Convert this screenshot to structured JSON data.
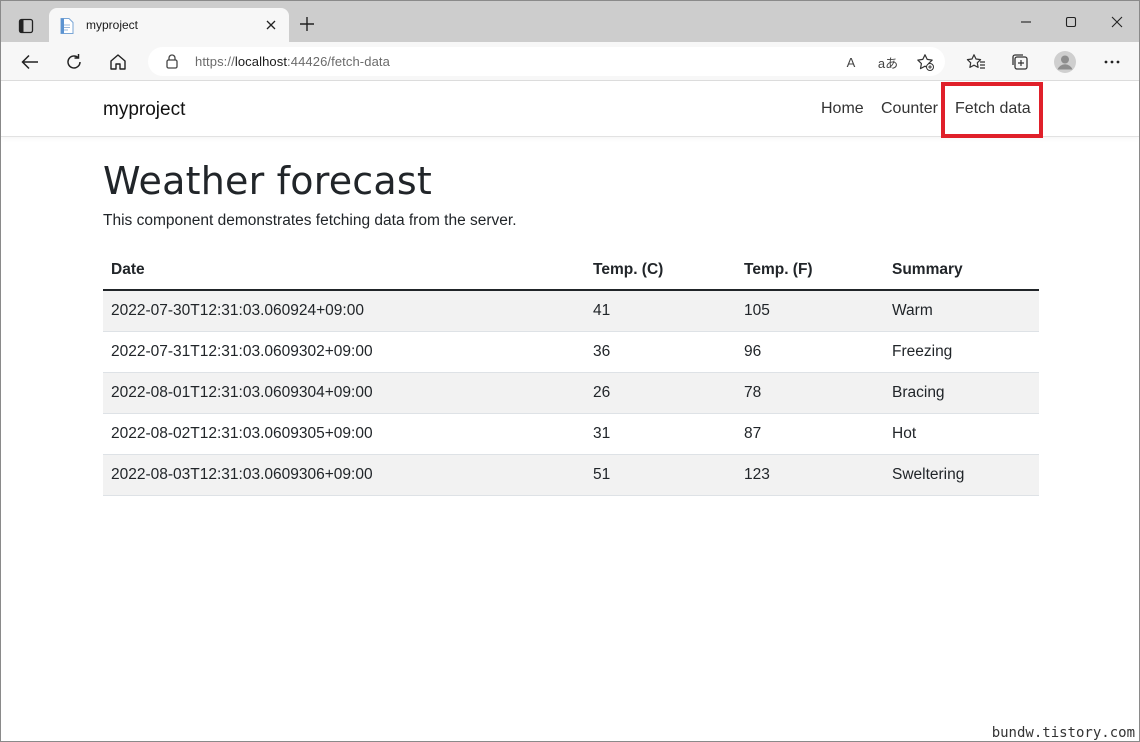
{
  "browser": {
    "tab_title": "myproject",
    "url_scheme": "https://",
    "url_host": "localhost",
    "url_rest": ":44426/fetch-data",
    "read_aloud_label": "A",
    "translate_label": "aあ"
  },
  "nav": {
    "brand": "myproject",
    "links": [
      {
        "label": "Home"
      },
      {
        "label": "Counter"
      },
      {
        "label": "Fetch data"
      }
    ],
    "highlight_color": "#e0202a"
  },
  "page": {
    "title": "Weather forecast",
    "lead": "This component demonstrates fetching data from the server.",
    "columns": [
      "Date",
      "Temp. (C)",
      "Temp. (F)",
      "Summary"
    ],
    "rows": [
      [
        "2022-07-30T12:31:03.060924+09:00",
        "41",
        "105",
        "Warm"
      ],
      [
        "2022-07-31T12:31:03.0609302+09:00",
        "36",
        "96",
        "Freezing"
      ],
      [
        "2022-08-01T12:31:03.0609304+09:00",
        "26",
        "78",
        "Bracing"
      ],
      [
        "2022-08-02T12:31:03.0609305+09:00",
        "31",
        "87",
        "Hot"
      ],
      [
        "2022-08-03T12:31:03.0609306+09:00",
        "51",
        "123",
        "Sweltering"
      ]
    ]
  },
  "watermark": "bundw.tistory.com"
}
